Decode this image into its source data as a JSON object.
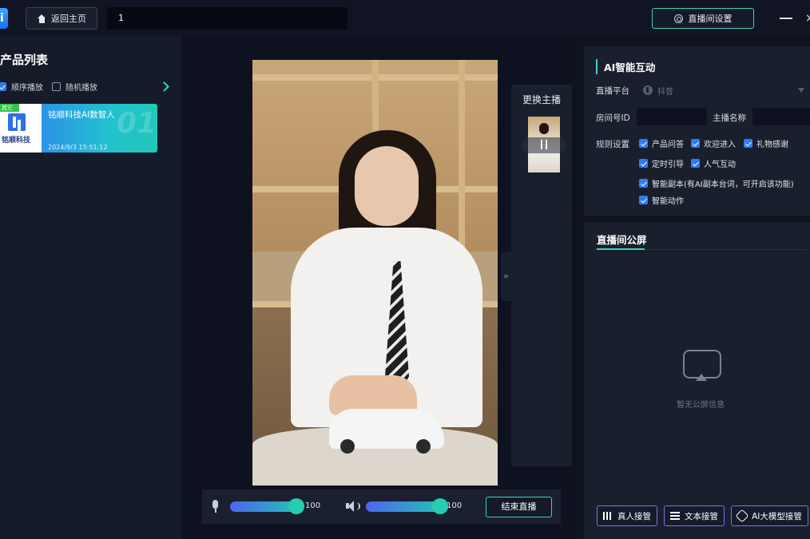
{
  "topbar": {
    "logo_text": "i",
    "home_label": "返回主页",
    "search_value": "1",
    "settings_label": "直播间设置",
    "close_glyph": "×"
  },
  "products": {
    "title": "产品列表",
    "play_modes": [
      {
        "label": "顺序播放",
        "checked": true
      },
      {
        "label": "随机播放",
        "checked": false
      }
    ],
    "items": [
      {
        "tag": "其它",
        "name": "铭顺科技AI数智人",
        "number": "01",
        "date": "2024/9/3 15:51:12",
        "brand": "铭顺科技"
      }
    ]
  },
  "host_switch": {
    "title": "更换主播"
  },
  "controls": {
    "mic_value": "100",
    "mic_level": 100,
    "speaker_value": "100",
    "speaker_level": 100,
    "end_label": "结束直播",
    "collapse_glyph": "»"
  },
  "ai_panel": {
    "title": "AI智能互动",
    "platform_label": "直播平台",
    "platform_value": "抖音",
    "room_id_label": "房间号ID",
    "room_id_value": "",
    "host_name_label": "主播名称",
    "host_name_value": "",
    "rules_label": "规则设置",
    "rules": [
      {
        "label": "产品问答",
        "checked": true
      },
      {
        "label": "欢迎进入",
        "checked": true
      },
      {
        "label": "礼物感谢",
        "checked": true
      },
      {
        "label": "定时引导",
        "checked": true
      },
      {
        "label": "人气互动",
        "checked": true
      },
      {
        "label": "智能副本(有AI副本台词，可开启该功能)",
        "checked": true
      },
      {
        "label": "智能动作",
        "checked": true
      }
    ]
  },
  "screen": {
    "title": "直播间公屏",
    "empty_text": "暂无公屏信息",
    "buttons": [
      "真人接管",
      "文本接管",
      "AI大模型接管"
    ]
  },
  "colors": {
    "accent": "#3fd1c2",
    "checkbox": "#2e7df6",
    "background": "#0f1320",
    "panel": "#1a1f2d"
  },
  "icons": [
    "home-icon",
    "gear-icon",
    "minimize-icon",
    "close-icon",
    "mic-icon",
    "speaker-icon",
    "tiktok-icon",
    "chevron-right-icon",
    "empty-screen-icon",
    "voice-bars-icon",
    "text-lines-icon",
    "ai-model-icon"
  ]
}
